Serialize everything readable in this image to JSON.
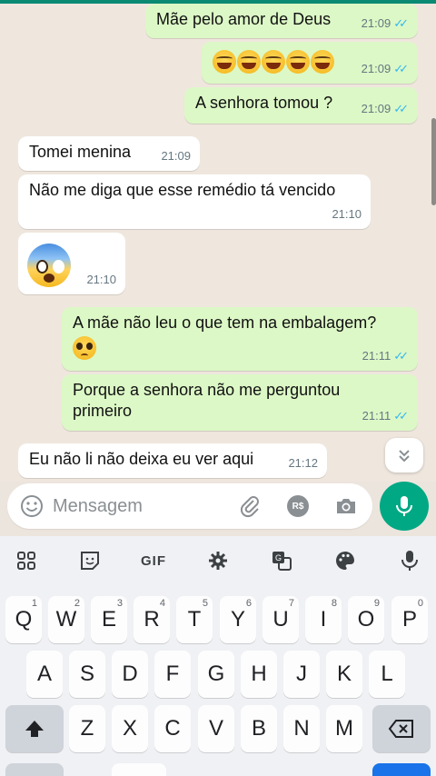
{
  "chat": {
    "messages": [
      {
        "dir": "out",
        "text": "Mãe pelo amor de Deus",
        "time": "21:09",
        "read": true
      },
      {
        "dir": "out",
        "emoji": "laugh",
        "count": 5,
        "time": "21:09",
        "read": true
      },
      {
        "dir": "out",
        "text": "A senhora tomou ?",
        "time": "21:09",
        "read": true
      },
      {
        "dir": "in",
        "text": "Tomei menina",
        "time": "21:09"
      },
      {
        "dir": "in",
        "text": "Não me diga que esse remédio tá vencido",
        "time": "21:10"
      },
      {
        "dir": "in",
        "emoji": "fearful-face",
        "time": "21:10"
      },
      {
        "dir": "out",
        "text": "A mãe não leu o que tem na embalagem?",
        "emoji": "pleading-face",
        "time": "21:11",
        "read": true
      },
      {
        "dir": "out",
        "text": "Porque a senhora não me perguntou primeiro",
        "time": "21:11",
        "read": true
      },
      {
        "dir": "in",
        "text": "Eu não li não deixa eu ver aqui",
        "time": "21:12"
      }
    ]
  },
  "composer": {
    "placeholder": "Mensagem",
    "pay_label": "R$"
  },
  "keyboard": {
    "toolbar": {
      "gif_label": "GIF"
    },
    "row1": [
      {
        "k": "Q",
        "n": "1"
      },
      {
        "k": "W",
        "n": "2"
      },
      {
        "k": "E",
        "n": "3"
      },
      {
        "k": "R",
        "n": "4"
      },
      {
        "k": "T",
        "n": "5"
      },
      {
        "k": "Y",
        "n": "6"
      },
      {
        "k": "U",
        "n": "7"
      },
      {
        "k": "I",
        "n": "8"
      },
      {
        "k": "O",
        "n": "9"
      },
      {
        "k": "P",
        "n": "0"
      }
    ],
    "row2": [
      "A",
      "S",
      "D",
      "F",
      "G",
      "H",
      "J",
      "K",
      "L"
    ],
    "row3": [
      "Z",
      "X",
      "C",
      "V",
      "B",
      "N",
      "M"
    ]
  },
  "colors": {
    "outgoing_bubble": "#dcf8c6",
    "incoming_bubble": "#ffffff",
    "read_ticks": "#34b7f1",
    "accent": "#00a884"
  }
}
